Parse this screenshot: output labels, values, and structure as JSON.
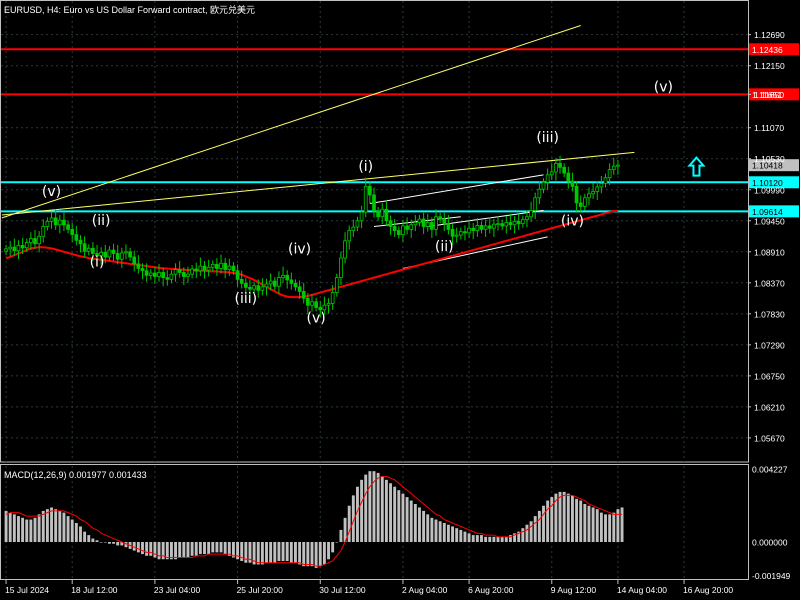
{
  "header": {
    "title": "EURUSD, H4:  Euro vs US Dollar Forward contract, 欧元兑美元"
  },
  "macd_header": {
    "title": "MACD(12,26,9) 0.001977 0.001433"
  },
  "colors": {
    "background": "#000000",
    "candles": "#00c800",
    "grid": "#2b3a3a",
    "axis_text": "#ffffff",
    "ma_line": "#ff0000",
    "trend_lines": "#ffff66",
    "channel_lines": "#ffffff",
    "resistance_lines": "#ff0000",
    "support_lines": "#00ffff",
    "macd_hist": "#c0c0c0",
    "macd_signal": "#ff0000",
    "arrow": "#00ffff"
  },
  "chart_data": [
    {
      "type": "candlestick",
      "symbol": "EURUSD",
      "timeframe": "H4",
      "ylim": [
        1.0525,
        1.1305
      ],
      "y_ticks": [
        "1.12690",
        "1.12150",
        "1.11650",
        "1.11070",
        "1.10530",
        "1.09990",
        "1.09450",
        "1.08910",
        "1.08370",
        "1.07830",
        "1.07290",
        "1.06750",
        "1.06210",
        "1.05670"
      ],
      "x_ticks": [
        "15 Jul 2024",
        "18 Jul 12:00",
        "23 Jul 04:00",
        "25 Jul 20:00",
        "30 Jul 12:00",
        "2 Aug 04:00",
        "6 Aug 20:00",
        "9 Aug 12:00",
        "14 Aug 04:00",
        "16 Aug 20:00"
      ],
      "x_tick_bars": [
        0,
        16,
        36,
        56,
        76,
        96,
        112,
        132,
        148,
        164
      ],
      "bars_total": 179,
      "close_series": [
        1.0896,
        1.0899,
        1.0893,
        1.0902,
        1.0898,
        1.0907,
        1.0914,
        1.0905,
        1.0918,
        1.0935,
        1.0944,
        1.095,
        1.0938,
        1.0946,
        1.0938,
        1.093,
        1.0921,
        1.0911,
        1.0905,
        1.0892,
        1.0897,
        1.0888,
        1.0884,
        1.089,
        1.0882,
        1.0894,
        1.0888,
        1.0878,
        1.0889,
        1.0891,
        1.0882,
        1.087,
        1.0862,
        1.0858,
        1.085,
        1.0854,
        1.0848,
        1.0855,
        1.0846,
        1.0843,
        1.0852,
        1.086,
        1.0855,
        1.0848,
        1.0852,
        1.0861,
        1.0858,
        1.0866,
        1.0859,
        1.0864,
        1.0869,
        1.0862,
        1.0871,
        1.086,
        1.0866,
        1.0858,
        1.0843,
        1.0836,
        1.0829,
        1.0826,
        1.0832,
        1.0824,
        1.083,
        1.0835,
        1.084,
        1.0831,
        1.0846,
        1.085,
        1.0842,
        1.0836,
        1.083,
        1.0822,
        1.081,
        1.0798,
        1.0804,
        1.0794,
        1.079,
        1.0798,
        1.0801,
        1.082,
        1.0846,
        1.088,
        1.091,
        1.0928,
        1.0934,
        1.0945,
        1.096,
        1.1005,
        1.099,
        1.0962,
        1.0952,
        1.0965,
        1.0945,
        1.0935,
        1.0928,
        1.0921,
        1.0936,
        1.093,
        1.0938,
        1.0942,
        1.0948,
        1.0935,
        1.0942,
        1.093,
        1.0952,
        1.0948,
        1.094,
        1.093,
        1.0918,
        1.092,
        1.0926,
        1.0924,
        1.0932,
        1.0928,
        1.0937,
        1.093,
        1.0936,
        1.0932,
        1.0939,
        1.094,
        1.0936,
        1.0942,
        1.0938,
        1.0944,
        1.094,
        1.0947,
        1.0952,
        1.0963,
        1.0985,
        1.1,
        1.1012,
        1.1025,
        1.103,
        1.1045,
        1.1038,
        1.1028,
        1.1014,
        1.1005,
        1.0976,
        1.097,
        1.0985,
        1.0992,
        1.0996,
        1.1004,
        1.101,
        1.102,
        1.1034,
        1.104,
        1.1042
      ],
      "ma_series": [
        1.088,
        1.0882,
        1.0885,
        1.0888,
        1.0891,
        1.0894,
        1.0897,
        1.0898,
        1.0899,
        1.0899,
        1.0898,
        1.0897,
        1.0895,
        1.0893,
        1.0891,
        1.0889,
        1.0887,
        1.0885,
        1.0883,
        1.0882,
        1.088,
        1.0879,
        1.0878,
        1.0877,
        1.0876,
        1.0875,
        1.0874,
        1.0873,
        1.0872,
        1.0871,
        1.087,
        1.0869,
        1.0868,
        1.0867,
        1.0866,
        1.0865,
        1.0864,
        1.0863,
        1.0862,
        1.0862,
        1.0861,
        1.0861,
        1.086,
        1.086,
        1.0859,
        1.0859,
        1.0858,
        1.0858,
        1.0858,
        1.0857,
        1.0857,
        1.0857,
        1.0856,
        1.0856,
        1.0855,
        1.0854,
        1.0853,
        1.0851,
        1.0848,
        1.0845,
        1.0842,
        1.0838,
        1.0834,
        1.083,
        1.0826,
        1.0822,
        1.0818,
        1.0815,
        1.0813,
        1.0812,
        1.0812,
        1.0812,
        1.0813,
        1.0814,
        1.0816,
        1.0818,
        1.082,
        1.0822,
        1.0824,
        1.0826,
        1.0828,
        1.083,
        1.0832,
        1.0834,
        1.0836,
        1.0838,
        1.084,
        1.0842,
        1.0844,
        1.0846,
        1.0848,
        1.085,
        1.0852,
        1.0854,
        1.0856,
        1.0858,
        1.086,
        1.0862,
        1.0864,
        1.0866,
        1.0868,
        1.087,
        1.0872,
        1.0874,
        1.0876,
        1.0878,
        1.088,
        1.0882,
        1.0884,
        1.0886,
        1.0888,
        1.089,
        1.0892,
        1.0894,
        1.0896,
        1.0898,
        1.09,
        1.0902,
        1.0904,
        1.0906,
        1.0908,
        1.091,
        1.0912,
        1.0914,
        1.0916,
        1.0918,
        1.092,
        1.0922,
        1.0924,
        1.0926,
        1.0928,
        1.093,
        1.0932,
        1.0934,
        1.0936,
        1.0938,
        1.094,
        1.0942,
        1.0944,
        1.0946,
        1.0948,
        1.095,
        1.0952,
        1.0954,
        1.0956,
        1.0958,
        1.096,
        1.0962,
        1.0962
      ],
      "horizontal_levels": [
        {
          "value": 1.12436,
          "label": "1.12436",
          "color": "#ff0000"
        },
        {
          "value": 1.11651,
          "label": "1.11651",
          "color": "#ff0000"
        },
        {
          "value": 1.10418,
          "label": "1.10418",
          "color": "#ffffff"
        },
        {
          "value": 1.1012,
          "label": "1.10120",
          "color": "#00ffff"
        },
        {
          "value": 1.09614,
          "label": "1.09614",
          "color": "#00ffff"
        }
      ],
      "wave_labels": [
        {
          "text": "(v)",
          "bar": 11,
          "price": 1.0988
        },
        {
          "text": "(i)",
          "bar": 22,
          "price": 1.0865
        },
        {
          "text": "(ii)",
          "bar": 23,
          "price": 1.0938
        },
        {
          "text": "(iii)",
          "bar": 58,
          "price": 1.0802
        },
        {
          "text": "(iv)",
          "bar": 71,
          "price": 1.0888
        },
        {
          "text": "(v)",
          "bar": 75,
          "price": 1.0768
        },
        {
          "text": "(i)",
          "bar": 87,
          "price": 1.1032
        },
        {
          "text": "(ii)",
          "bar": 106,
          "price": 1.0892
        },
        {
          "text": "(iii)",
          "bar": 131,
          "price": 1.1082
        },
        {
          "text": "(iv)",
          "bar": 137,
          "price": 1.0937
        },
        {
          "text": "(v)",
          "bar": 159,
          "price": 1.117
        }
      ]
    },
    {
      "type": "macd",
      "title": "MACD(12,26,9) 0.001977 0.001433",
      "ylim": [
        -0.0022,
        0.0044
      ],
      "y_ticks": [
        "0.004227",
        "0.000000",
        "-0.001949"
      ],
      "histogram": [
        0.0018,
        0.0017,
        0.0016,
        0.0015,
        0.0014,
        0.0013,
        0.0013,
        0.0014,
        0.0016,
        0.0018,
        0.0019,
        0.002,
        0.0019,
        0.0018,
        0.0017,
        0.0015,
        0.0013,
        0.0011,
        0.0009,
        0.0006,
        0.0004,
        0.0002,
        0.0001,
        0.0,
        0.0,
        -0.0001,
        -0.0001,
        -0.0002,
        -0.0002,
        -0.0003,
        -0.0004,
        -0.0005,
        -0.0006,
        -0.0007,
        -0.0008,
        -0.0008,
        -0.0009,
        -0.001,
        -0.001,
        -0.001,
        -0.001,
        -0.001,
        -0.0009,
        -0.0009,
        -0.0009,
        -0.0008,
        -0.0008,
        -0.0007,
        -0.0007,
        -0.0007,
        -0.0006,
        -0.0006,
        -0.0006,
        -0.0007,
        -0.0008,
        -0.0009,
        -0.001,
        -0.0011,
        -0.0012,
        -0.0012,
        -0.0013,
        -0.0013,
        -0.0013,
        -0.0012,
        -0.0012,
        -0.0012,
        -0.0011,
        -0.0011,
        -0.0011,
        -0.0012,
        -0.0012,
        -0.0013,
        -0.0014,
        -0.0014,
        -0.0014,
        -0.0015,
        -0.0014,
        -0.0013,
        -0.001,
        -0.0006,
        0.0,
        0.0007,
        0.0014,
        0.0021,
        0.0027,
        0.0032,
        0.0036,
        0.0039,
        0.0041,
        0.0041,
        0.004,
        0.0038,
        0.0036,
        0.0034,
        0.0032,
        0.003,
        0.0028,
        0.0026,
        0.0024,
        0.0022,
        0.002,
        0.0018,
        0.0016,
        0.0014,
        0.0013,
        0.0012,
        0.0011,
        0.001,
        0.0009,
        0.0008,
        0.0007,
        0.0006,
        0.0005,
        0.0004,
        0.0004,
        0.0004,
        0.0003,
        0.0003,
        0.0003,
        0.0003,
        0.0003,
        0.0003,
        0.0004,
        0.0005,
        0.0006,
        0.0008,
        0.001,
        0.0012,
        0.0015,
        0.0018,
        0.0021,
        0.0024,
        0.0026,
        0.0028,
        0.0029,
        0.0029,
        0.0028,
        0.0027,
        0.0025,
        0.0024,
        0.0022,
        0.0021,
        0.002,
        0.0019,
        0.0017,
        0.0016,
        0.0016,
        0.0017,
        0.0019,
        0.002
      ],
      "signal": [
        0.0016,
        0.0017,
        0.0017,
        0.0017,
        0.0016,
        0.0015,
        0.0015,
        0.0015,
        0.0015,
        0.0016,
        0.0017,
        0.0018,
        0.0018,
        0.0018,
        0.0018,
        0.0017,
        0.0016,
        0.0015,
        0.0013,
        0.0012,
        0.001,
        0.0008,
        0.0007,
        0.0005,
        0.0004,
        0.0003,
        0.0002,
        0.0001,
        0.0,
        -0.0001,
        -0.0002,
        -0.0003,
        -0.0004,
        -0.0005,
        -0.0006,
        -0.0006,
        -0.0007,
        -0.0008,
        -0.0008,
        -0.0009,
        -0.0009,
        -0.0009,
        -0.0009,
        -0.0009,
        -0.0009,
        -0.0009,
        -0.0008,
        -0.0008,
        -0.0008,
        -0.0007,
        -0.0007,
        -0.0007,
        -0.0007,
        -0.0007,
        -0.0007,
        -0.0008,
        -0.0008,
        -0.0009,
        -0.001,
        -0.001,
        -0.0011,
        -0.0012,
        -0.0012,
        -0.0012,
        -0.0012,
        -0.0012,
        -0.0012,
        -0.0012,
        -0.0012,
        -0.0012,
        -0.0012,
        -0.0012,
        -0.0013,
        -0.0013,
        -0.0013,
        -0.0014,
        -0.0014,
        -0.0013,
        -0.0012,
        -0.0011,
        -0.0008,
        -0.0005,
        0.0,
        0.0006,
        0.0012,
        0.0018,
        0.0023,
        0.0028,
        0.0032,
        0.0035,
        0.0037,
        0.0038,
        0.0038,
        0.0037,
        0.0036,
        0.0034,
        0.0032,
        0.003,
        0.0028,
        0.0026,
        0.0024,
        0.0022,
        0.002,
        0.0018,
        0.0016,
        0.0015,
        0.0013,
        0.0012,
        0.0011,
        0.001,
        0.0009,
        0.0008,
        0.0007,
        0.0006,
        0.0005,
        0.0005,
        0.0004,
        0.0004,
        0.0004,
        0.0003,
        0.0003,
        0.0003,
        0.0003,
        0.0004,
        0.0005,
        0.0006,
        0.0007,
        0.0009,
        0.0011,
        0.0013,
        0.0016,
        0.0019,
        0.0021,
        0.0024,
        0.0026,
        0.0027,
        0.0027,
        0.0027,
        0.0026,
        0.0025,
        0.0024,
        0.0022,
        0.0021,
        0.002,
        0.0019,
        0.0018,
        0.0017,
        0.0016,
        0.0016,
        0.0016
      ]
    }
  ]
}
